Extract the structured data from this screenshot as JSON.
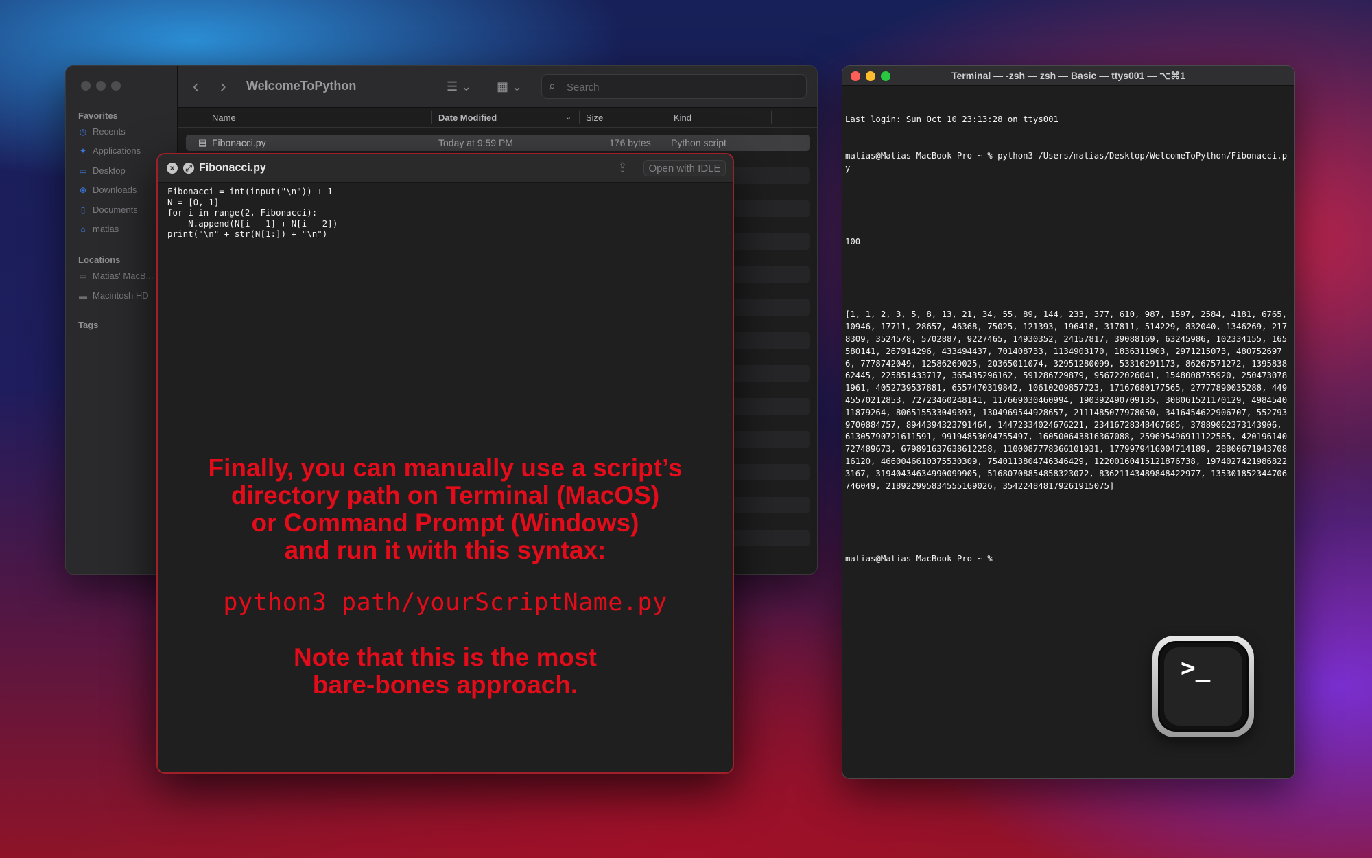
{
  "finder": {
    "title": "WelcomeToPython",
    "search_placeholder": "Search",
    "sidebar": {
      "favorites_label": "Favorites",
      "favorites": [
        "Recents",
        "Applications",
        "Desktop",
        "Downloads",
        "Documents",
        "matias"
      ],
      "locations_label": "Locations",
      "locations": [
        "Matias' MacB...",
        "Macintosh HD"
      ],
      "tags_label": "Tags"
    },
    "columns": {
      "name": "Name",
      "date": "Date Modified",
      "size": "Size",
      "kind": "Kind"
    },
    "file": {
      "name": "Fibonacci.py",
      "date": "Today at 9:59 PM",
      "size": "176 bytes",
      "kind": "Python script"
    }
  },
  "quicklook": {
    "title": "Fibonacci.py",
    "open_button": "Open with IDLE",
    "code": "Fibonacci = int(input(\"\\n\")) + 1\nN = [0, 1]\nfor i in range(2, Fibonacci):\n    N.append(N[i - 1] + N[i - 2])\nprint(\"\\n\" + str(N[1:]) + \"\\n\")",
    "caption_lines": [
      "Finally, you can manually use a script’s",
      "directory path on Terminal (MacOS)",
      "or Command Prompt (Windows)",
      "and run it with this syntax:"
    ],
    "syntax": "python3 path/yourScriptName.py",
    "note_lines": [
      "Note that this is the most",
      "bare-bones approach."
    ]
  },
  "terminal": {
    "title": "Terminal — -zsh — zsh — Basic — ttys001 — ⌥⌘1",
    "lines": [
      "Last login: Sun Oct 10 23:13:28 on ttys001",
      "matias@Matias-MacBook-Pro ~ % python3 /Users/matias/Desktop/WelcomeToPython/Fibonacci.py",
      "",
      "100",
      "",
      "[1, 1, 2, 3, 5, 8, 13, 21, 34, 55, 89, 144, 233, 377, 610, 987, 1597, 2584, 4181, 6765, 10946, 17711, 28657, 46368, 75025, 121393, 196418, 317811, 514229, 832040, 1346269, 2178309, 3524578, 5702887, 9227465, 14930352, 24157817, 39088169, 63245986, 102334155, 165580141, 267914296, 433494437, 701408733, 1134903170, 1836311903, 2971215073, 4807526976, 7778742049, 12586269025, 20365011074, 32951280099, 53316291173, 86267571272, 139583862445, 225851433717, 365435296162, 591286729879, 956722026041, 1548008755920, 2504730781961, 4052739537881, 6557470319842, 10610209857723, 17167680177565, 27777890035288, 44945570212853, 72723460248141, 117669030460994, 190392490709135, 308061521170129, 498454011879264, 806515533049393, 1304969544928657, 2111485077978050, 3416454622906707, 5527939700884757, 8944394323791464, 14472334024676221, 23416728348467685, 37889062373143906, 61305790721611591, 99194853094755497, 160500643816367088, 259695496911122585, 420196140727489673, 679891637638612258, 1100087778366101931, 1779979416004714189, 2880067194370816120, 4660046610375530309, 7540113804746346429, 12200160415121876738, 19740274219868223167, 31940434634990099905, 51680708854858323072, 83621143489848422977, 135301852344706746049, 218922995834555169026, 354224848179261915075]",
      "",
      "matias@Matias-MacBook-Pro ~ %"
    ]
  },
  "colors": {
    "caption_red": "#e30c1a",
    "close": "#ff5f57",
    "minimize": "#febc2e",
    "zoom": "#28c840"
  },
  "dock_icon": "terminal-app-icon"
}
